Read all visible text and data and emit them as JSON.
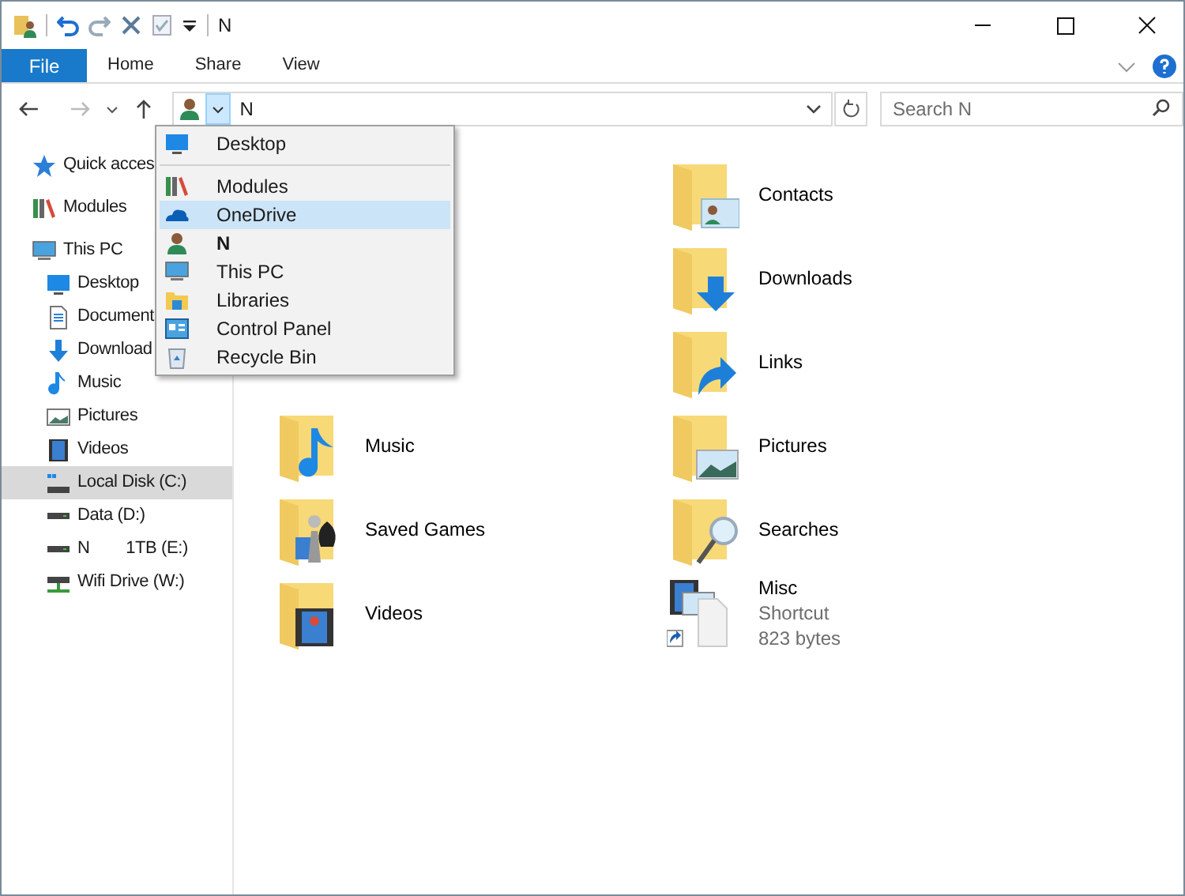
{
  "window": {
    "title": "N"
  },
  "ribbon_tabs": [
    {
      "label": "File",
      "kind": "file"
    },
    {
      "label": "Home",
      "kind": "tab"
    },
    {
      "label": "Share",
      "kind": "tab"
    },
    {
      "label": "View",
      "kind": "tab"
    }
  ],
  "address": {
    "value": "N"
  },
  "search": {
    "placeholder": "Search N"
  },
  "address_menu": [
    {
      "label": "Desktop",
      "kind": "desktop",
      "selected": false,
      "bold": false
    },
    {
      "label": "Modules",
      "kind": "modules",
      "selected": false,
      "bold": false
    },
    {
      "label": "OneDrive",
      "kind": "onedrive",
      "selected": true,
      "bold": false
    },
    {
      "label": "N",
      "kind": "user",
      "selected": false,
      "bold": true
    },
    {
      "label": "This PC",
      "kind": "pc",
      "selected": false,
      "bold": false
    },
    {
      "label": "Libraries",
      "kind": "libraries",
      "selected": false,
      "bold": false
    },
    {
      "label": "Control Panel",
      "kind": "control",
      "selected": false,
      "bold": false
    },
    {
      "label": "Recycle Bin",
      "kind": "recycle",
      "selected": false,
      "bold": false
    }
  ],
  "nav": [
    {
      "label": "Quick acces",
      "kind": "star",
      "selected": false
    },
    {
      "label": "Modules",
      "kind": "modules",
      "selected": false
    },
    {
      "label": "This PC",
      "kind": "pc",
      "selected": false,
      "children": [
        {
          "label": "Desktop",
          "kind": "desktop",
          "selected": false
        },
        {
          "label": "Document",
          "kind": "document",
          "selected": false
        },
        {
          "label": "Download",
          "kind": "download",
          "selected": false
        },
        {
          "label": "Music",
          "kind": "music",
          "selected": false
        },
        {
          "label": "Pictures",
          "kind": "pictures",
          "selected": false
        },
        {
          "label": "Videos",
          "kind": "videos",
          "selected": false
        },
        {
          "label": "Local Disk (C:)",
          "kind": "windisk",
          "selected": true
        },
        {
          "label": "Data (D:)",
          "kind": "disk",
          "selected": false
        },
        {
          "label": "N        1TB (E:)",
          "kind": "disk",
          "selected": false
        },
        {
          "label": "Wifi Drive (W:)",
          "kind": "netdisk",
          "selected": false
        }
      ]
    }
  ],
  "content_left": [
    {
      "name": "Music",
      "kind": "music"
    },
    {
      "name": "Saved Games",
      "kind": "games"
    },
    {
      "name": "Videos",
      "kind": "videos"
    }
  ],
  "content_right": [
    {
      "name": "Contacts",
      "kind": "contacts"
    },
    {
      "name": "Downloads",
      "kind": "downloads"
    },
    {
      "name": "Links",
      "kind": "links"
    },
    {
      "name": "Pictures",
      "kind": "pictures"
    },
    {
      "name": "Searches",
      "kind": "searches"
    },
    {
      "name": "Misc",
      "kind": "shortcut",
      "type": "Shortcut",
      "size": "823 bytes"
    }
  ]
}
